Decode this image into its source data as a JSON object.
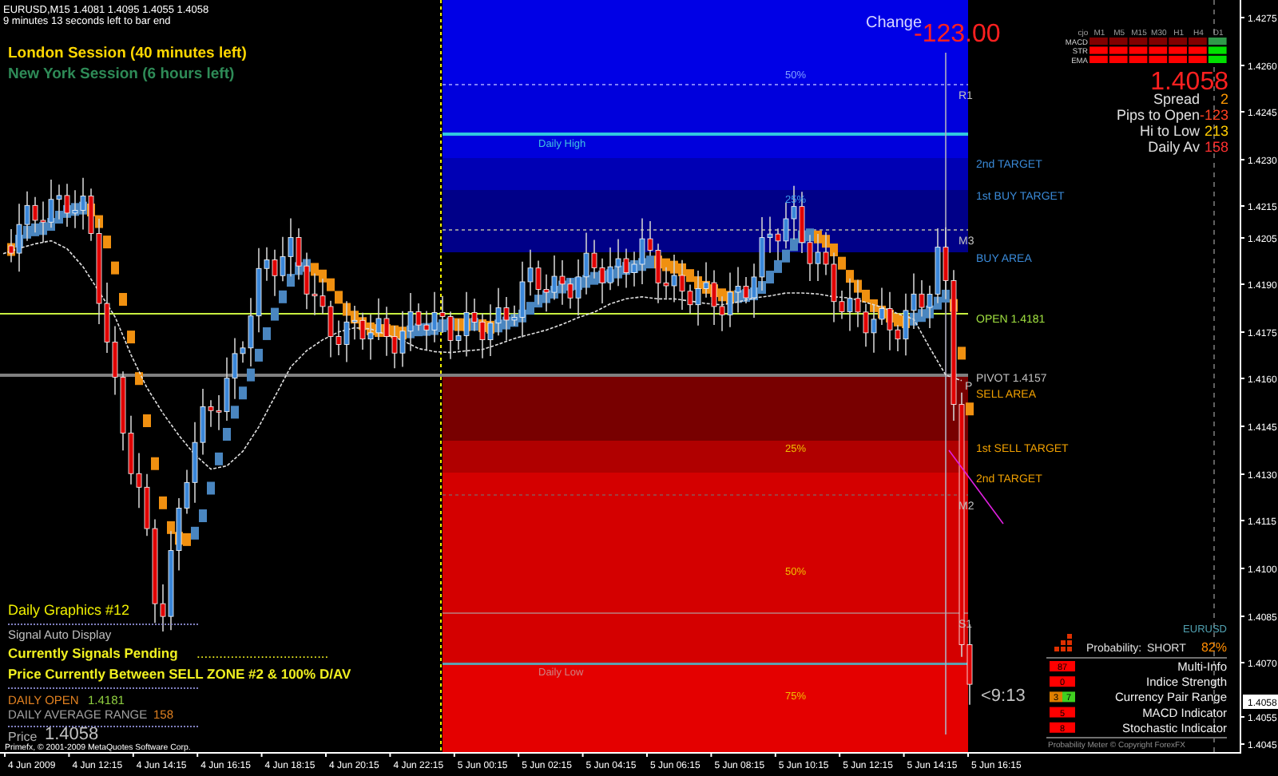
{
  "chart_header": {
    "symbol_line": "EURUSD,M15  1.4081 1.4095 1.4055 1.4058",
    "bar_timer": "9 minutes 13 seconds left to bar end"
  },
  "sessions": [
    {
      "text": "London Session (40 minutes left)",
      "color": "#ffd700"
    },
    {
      "text": "New York Session (6 hours left)",
      "color": "#2e8b57"
    }
  ],
  "change": {
    "label": "Change",
    "value": "-123.00"
  },
  "signal_matrix": {
    "corner": "cjo",
    "timeframes": [
      "M1",
      "M5",
      "M15",
      "M30",
      "H1",
      "H4",
      "D1"
    ],
    "rows": [
      {
        "name": "MACD",
        "cells": [
          {
            "color": "#800000"
          },
          {
            "color": "#800000"
          },
          {
            "color": "#800000"
          },
          {
            "color": "#800000"
          },
          {
            "color": "#800000"
          },
          {
            "color": "#800000"
          },
          {
            "color": "#2f9a4a"
          }
        ]
      },
      {
        "name": "STR",
        "cells": [
          {
            "color": "#ff0000"
          },
          {
            "color": "#ff0000"
          },
          {
            "color": "#ff0000"
          },
          {
            "color": "#ff0000"
          },
          {
            "color": "#ff0000"
          },
          {
            "color": "#ff0000"
          },
          {
            "color": "#00e000"
          }
        ]
      },
      {
        "name": "EMA",
        "cells": [
          {
            "color": "#ff0000"
          },
          {
            "color": "#ff0000"
          },
          {
            "color": "#ff0000"
          },
          {
            "color": "#ff0000"
          },
          {
            "color": "#ff0000"
          },
          {
            "color": "#ff0000"
          },
          {
            "color": "#00e000"
          }
        ]
      }
    ]
  },
  "price_panel": {
    "price": "1.4058",
    "stats": [
      {
        "label": "Spread",
        "value": "2",
        "color": "#ff9900"
      },
      {
        "label": "Pips to Open",
        "value": "-123",
        "color": "#ff4020"
      },
      {
        "label": "Hi to Low",
        "value": "213",
        "color": "#ffcc00"
      },
      {
        "label": "Daily Av",
        "value": "158",
        "color": "#ff3030"
      }
    ]
  },
  "zones": {
    "percent_labels": [
      "50%",
      "25%",
      "25%",
      "50%",
      "75%"
    ],
    "pivot_labels": [
      "R1",
      "M3",
      "P",
      "M2",
      "S1"
    ],
    "daily_high": "Daily High",
    "daily_low": "Daily Low"
  },
  "targets": [
    {
      "text": "2nd TARGET",
      "kind": "buy"
    },
    {
      "text": "1st BUY TARGET",
      "kind": "buy"
    },
    {
      "text": "BUY AREA",
      "kind": "buy"
    },
    {
      "text": "OPEN 1.4181",
      "kind": "open"
    },
    {
      "text": "PIVOT 1.4157",
      "kind": "pivot"
    },
    {
      "text": "SELL AREA",
      "kind": "sell"
    },
    {
      "text": "1st SELL TARGET",
      "kind": "sell"
    },
    {
      "text": "2nd TARGET",
      "kind": "sell"
    }
  ],
  "countdown": "<9:13",
  "info_panel": {
    "title": "Daily Graphics #12",
    "subtitle": "Signal Auto Display",
    "signal_status": "Currently Signals Pending",
    "dots": "...................................",
    "zone_message": "Price Currently Between SELL ZONE #2 & 100% D/AV",
    "daily_open": {
      "label": "DAILY OPEN",
      "value": "1.4181"
    },
    "daily_range": {
      "label": "DAILY AVERAGE RANGE",
      "value": "158"
    },
    "price": {
      "label": "Price",
      "value": "1.4058"
    }
  },
  "copyright": "Primefx, © 2001-2009 MetaQuotes Software Corp.",
  "probability_meter": {
    "symbol": "EURUSD",
    "label": "Probability:",
    "direction": "SHORT",
    "percent": "82%",
    "rows": [
      {
        "label": "Multi-Info",
        "badges": [
          {
            "text": "87",
            "color": "#ff0000"
          }
        ]
      },
      {
        "label": "Indice Strength",
        "badges": [
          {
            "text": "0",
            "color": "#ff0000"
          }
        ]
      },
      {
        "label": "Currency Pair Range",
        "badges": [
          {
            "text": "3",
            "color": "#e08000"
          },
          {
            "text": "7",
            "color": "#40d020"
          }
        ]
      },
      {
        "label": "MACD Indicator",
        "badges": [
          {
            "text": "5",
            "color": "#ff0000"
          }
        ]
      },
      {
        "label": "Stochastic Indicator",
        "badges": [
          {
            "text": "8",
            "color": "#ff0000"
          }
        ]
      }
    ],
    "footer": "Probability Meter © Copyright ForexFX"
  },
  "price_axis": {
    "ticks": [
      "1.4275",
      "1.4260",
      "1.4245",
      "1.4230",
      "1.4215",
      "1.4205",
      "1.4190",
      "1.4175",
      "1.4160",
      "1.4145",
      "1.4130",
      "1.4115",
      "1.4100",
      "1.4085",
      "1.4070",
      "1.4055",
      "1.4045"
    ],
    "current": "1.4058"
  },
  "time_axis": [
    "4 Jun 2009",
    "4 Jun 12:15",
    "4 Jun 14:15",
    "4 Jun 16:15",
    "4 Jun 18:15",
    "4 Jun 20:15",
    "4 Jun 22:15",
    "5 Jun 00:15",
    "5 Jun 02:15",
    "5 Jun 04:15",
    "5 Jun 06:15",
    "5 Jun 08:15",
    "5 Jun 10:15",
    "5 Jun 12:15",
    "5 Jun 14:15",
    "5 Jun 16:15"
  ]
}
